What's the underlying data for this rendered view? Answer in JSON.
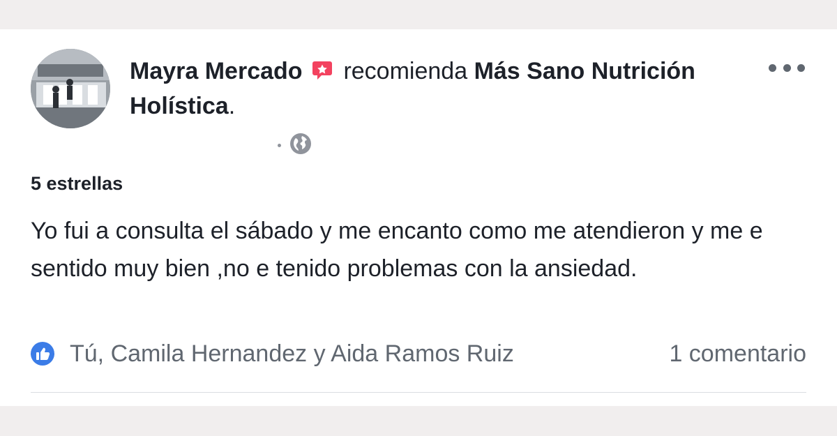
{
  "post": {
    "author": "Mayra Mercado",
    "verb": "recomienda",
    "page_name": "Más Sano Nutrición Holística",
    "period": ".",
    "icons": {
      "recommend": "recommend-star-icon",
      "audience": "globe-icon",
      "more": "more-options-icon",
      "like": "like-thumb-icon"
    },
    "rating_label": "5 estrellas",
    "body": "Yo fui a consulta el sábado y me encanto como me atendieron y me e sentido muy bien ,no e tenido problemas con la ansiedad.",
    "reactions": {
      "names": "Tú, Camila Hernandez y Aida Ramos Ruiz"
    },
    "comments_label": "1 comentario"
  },
  "colors": {
    "like_blue": "#3b7ce7",
    "recommend_red": "#f3425f",
    "secondary_text": "#606770"
  }
}
